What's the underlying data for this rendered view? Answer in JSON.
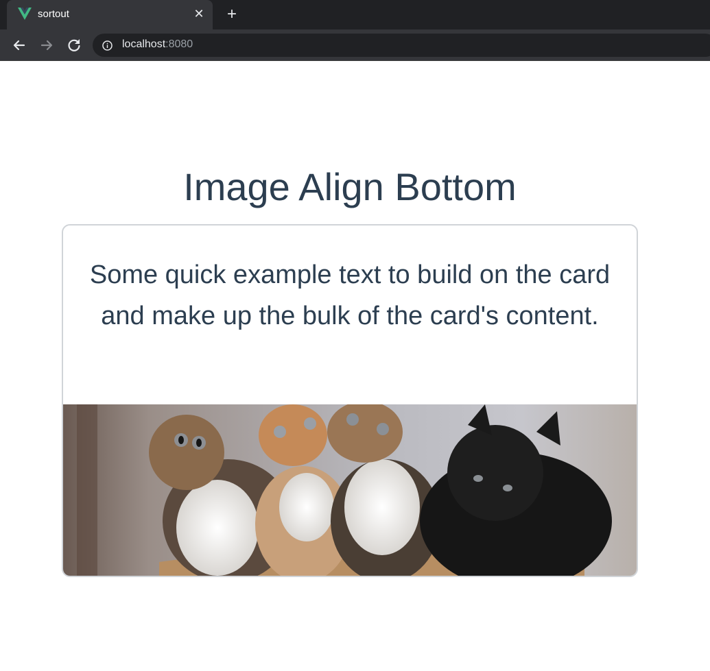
{
  "browser": {
    "tab_title": "sortout",
    "url_host": "localhost",
    "url_port": ":8080",
    "tab_close_glyph": "✕",
    "new_tab_glyph": "+"
  },
  "page": {
    "title": "Image Align Bottom",
    "card_text": "Some quick example text to build on the card and make up the bulk of the card's content.",
    "card_image_icon": "kittens-photo"
  },
  "colors": {
    "text": "#2c3e50",
    "chrome_dark": "#202124",
    "chrome_tab": "#35363a",
    "vue_green": "#42b883"
  }
}
